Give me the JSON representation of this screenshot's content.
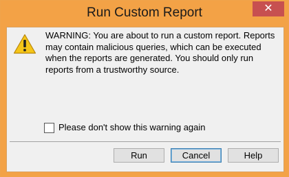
{
  "dialog": {
    "title": "Run Custom Report",
    "close_label": "✕",
    "icon": "warning-icon",
    "message": "WARNING: You are about to run a custom report. Reports may contain malicious queries, which can be executed when the reports are generated. You should only run reports from a trustworthy source.",
    "checkbox": {
      "label": "Please don't show this warning again",
      "checked": false
    },
    "buttons": {
      "run": "Run",
      "cancel": "Cancel",
      "help": "Help"
    }
  },
  "colors": {
    "titlebar": "#f3a246",
    "close_button": "#c75050",
    "client": "#f0f0f0",
    "button": "#e1e1e1",
    "default_button_border": "#3c7fb1",
    "warning_yellow": "#f5c518"
  }
}
